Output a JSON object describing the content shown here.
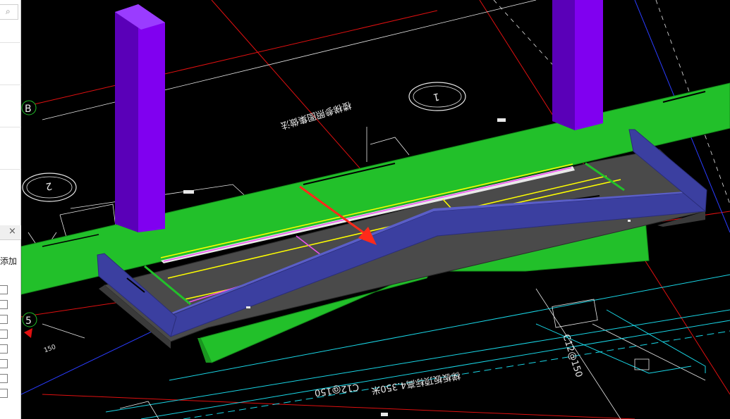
{
  "left_panel": {
    "search_icon": "search-icon",
    "close_icon": "close-icon",
    "close_glyph": "×",
    "add_label": "添加",
    "checkbox_count": 8
  },
  "canvas": {
    "axis_labels": {
      "b": "B",
      "five": "5"
    },
    "grid_numbers": {
      "one": "1",
      "two": "2"
    },
    "annotations": {
      "note_mirrored": "楼梯参照图集做法",
      "rebar_left": "C12@150",
      "rebar_right": "C12@150",
      "elevation": "梯板板顶标高4.350米",
      "dim_small": "150"
    },
    "colors": {
      "column": "#7b00e6",
      "floor": "#22c02a",
      "ramp_wall": "#3b3fa0",
      "slab_gray": "#4a4a4a",
      "arrow": "#ff2a1a",
      "grid_red": "#e01010",
      "grid_cyan": "#19d6e6"
    }
  }
}
